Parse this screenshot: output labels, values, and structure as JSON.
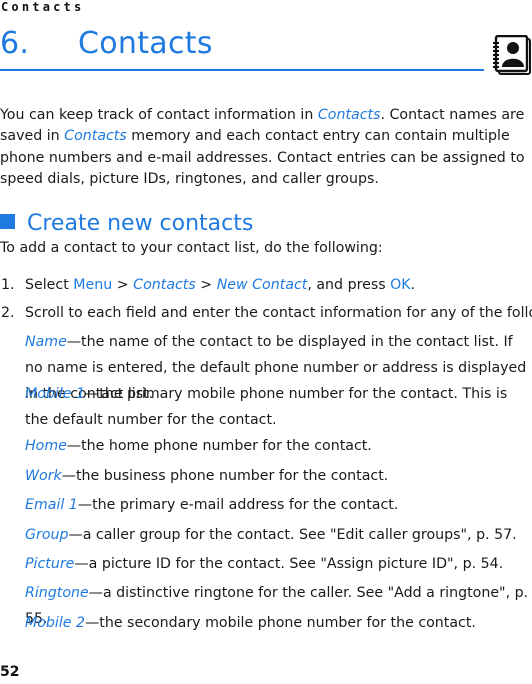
{
  "running_head": "Contacts",
  "chapter": {
    "number": "6.",
    "title": "Contacts",
    "icon": "contacts-book-icon"
  },
  "intro": {
    "parts": [
      "You can keep track of contact information in ",
      "Contacts",
      ". Contact names are saved in ",
      "Contacts",
      " memory and each contact entry can contain multiple phone numbers and e-mail addresses. Contact entries can be assigned to speed dials, picture IDs, ringtones, and caller groups."
    ]
  },
  "section": {
    "bullet": "square-bullet",
    "title": "Create new contacts"
  },
  "lead": "To add a contact to your contact list, do the following:",
  "steps": [
    {
      "number": "1.",
      "select": "Select ",
      "menu": "Menu",
      "sep1": " > ",
      "contacts": "Contacts",
      "sep2": " > ",
      "new_contact": "New Contact",
      "and_press": ", and press ",
      "ok": "OK",
      "end": "."
    },
    {
      "number": "2.",
      "text": "Scroll to each field and enter the contact information for any of the following:"
    }
  ],
  "fields": [
    {
      "label": "Name",
      "desc": "—the name of the contact to be displayed in the contact list. If no name is entered, the default phone number or address is displayed in the contact list."
    },
    {
      "label": "Mobile 1",
      "desc": "—the primary mobile phone number for the contact. This is the default number for the contact."
    },
    {
      "label": "Home",
      "desc": "—the home phone number for the contact."
    },
    {
      "label": "Work",
      "desc": "—the business phone number for the contact."
    },
    {
      "label": "Email 1",
      "desc": "—the primary e-mail address for the contact."
    },
    {
      "label": "Group",
      "desc": "—a caller group for the contact. See \"Edit caller groups\", p. 57."
    },
    {
      "label": "Picture",
      "desc": "—a picture ID for the contact. See \"Assign picture ID\", p. 54."
    },
    {
      "label": "Ringtone",
      "desc": "—a distinctive ringtone for the caller. See \"Add a ringtone\", p. 55."
    },
    {
      "label": "Mobile 2",
      "desc": "—the secondary mobile phone number for the contact."
    }
  ],
  "page_number": "52",
  "colors": {
    "accent": "#1f7ae0",
    "text": "#1a1a1a"
  }
}
